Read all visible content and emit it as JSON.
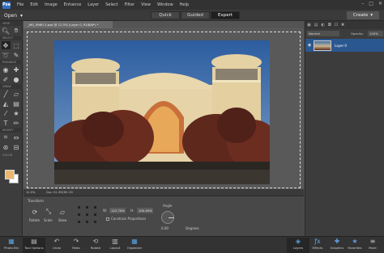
{
  "menu": {
    "app_icon": "Pse",
    "items": [
      "File",
      "Edit",
      "Image",
      "Enhance",
      "Layer",
      "Select",
      "Filter",
      "View",
      "Window",
      "Help"
    ],
    "window_controls": [
      "–",
      "□",
      "✕"
    ]
  },
  "modebar": {
    "open_label": "Open",
    "modes": [
      "Quick",
      "Guided",
      "Expert"
    ],
    "active_mode": "Expert",
    "create_label": "Create"
  },
  "toolbox": {
    "sections": [
      "VIEW",
      "SELECT",
      "ENHANCE",
      "DRAW",
      "MODIFY",
      "COLOR"
    ]
  },
  "document": {
    "tab_title": "_MG_9960-3.psd @ 12.5% (Layer 0, RGB/8*) *",
    "zoom": "12.5%",
    "doc_info": "Doc: 61.9M/89.1M"
  },
  "layers": {
    "blend_mode": "Normal",
    "opacity_label": "Opacity:",
    "opacity_value": "100%",
    "layer_name": "Layer 0"
  },
  "tool_options": {
    "title": "Transform",
    "buttons": [
      "Rotate",
      "Scale",
      "Skew"
    ],
    "w_label": "W:",
    "w_value": "122.70%",
    "h_label": "H:",
    "h_value": "100.00%",
    "constrain_label": "Constrain Proportions",
    "angle_label": "Angle",
    "angle_value": "0.00",
    "degrees_label": "Degrees"
  },
  "bottombar": {
    "left": [
      "Photo Bin",
      "Tool Options",
      "Undo",
      "Redo",
      "Rotate",
      "Layout",
      "Organizer"
    ],
    "right": [
      "Layers",
      "Effects",
      "Graphics",
      "Favorites",
      "More"
    ]
  },
  "colors": {
    "foreground": "#e8b870",
    "background": "#ffffff",
    "selected_layer": "#2b5790"
  }
}
